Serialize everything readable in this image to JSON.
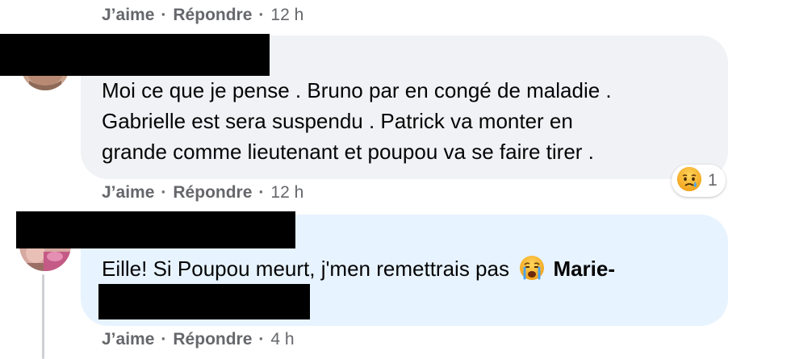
{
  "top_actions": {
    "like": "J’aime",
    "dot1": "·",
    "reply": "Répondre",
    "dot2": "·",
    "time": "12 h"
  },
  "comment1": {
    "lines": [
      "Moi ce que je pense . Bruno par en congé de maladie .",
      "Gabrielle est sera suspendu . Patrick va monter en",
      "grande comme lieutenant et poupou va se faire tirer ."
    ],
    "reaction": {
      "icon": "sad-face-icon",
      "count": "1"
    },
    "actions": {
      "like": "J’aime",
      "dot1": "·",
      "reply": "Répondre",
      "dot2": "·",
      "time": "12 h"
    }
  },
  "comment2": {
    "text": "Eille! Si Poupou meurt, j'men remettrais pas",
    "emoji": "crying-face-icon",
    "mention": "Marie-",
    "actions": {
      "like": "J’aime",
      "dot1": "·",
      "reply": "Répondre",
      "dot2": "·",
      "time": "4 h"
    }
  },
  "colors": {
    "bubble_grey": "#f0f2f5",
    "bubble_blue": "#e7f3ff",
    "meta_text": "#65676b",
    "redaction": "#000000"
  }
}
